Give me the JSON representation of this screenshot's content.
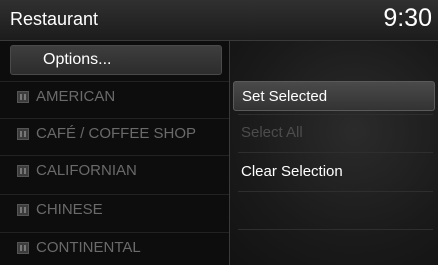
{
  "header": {
    "title": "Restaurant",
    "clock": "9:30"
  },
  "list": {
    "options_label": "Options...",
    "categories": [
      {
        "label": "AMERICAN",
        "icon": "restaurant-icon"
      },
      {
        "label": "CAFÉ / COFFEE SHOP",
        "icon": "restaurant-icon"
      },
      {
        "label": "CALIFORNIAN",
        "icon": "restaurant-icon"
      },
      {
        "label": "CHINESE",
        "icon": "restaurant-icon"
      },
      {
        "label": "CONTINENTAL",
        "icon": "restaurant-icon"
      }
    ]
  },
  "menu": {
    "set_selected": "Set Selected",
    "select_all": "Select All",
    "clear_selection": "Clear Selection"
  },
  "colors": {
    "background": "#101010",
    "text_active": "#ffffff",
    "text_disabled": "#6a6a6a"
  }
}
